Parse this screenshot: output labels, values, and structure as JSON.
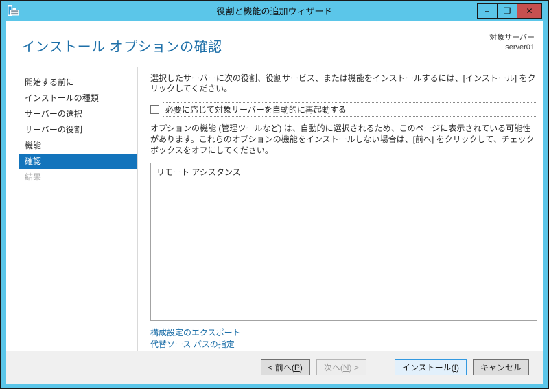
{
  "window": {
    "title": "役割と機能の追加ウィザード",
    "controls": {
      "minimize": "–",
      "maximize": "❐",
      "close": "✕"
    }
  },
  "header": {
    "title": "インストール オプションの確認",
    "target_server_label": "対象サーバー",
    "target_server_name": "server01"
  },
  "sidebar": {
    "items": [
      {
        "label": "開始する前に",
        "state": "normal"
      },
      {
        "label": "インストールの種類",
        "state": "normal"
      },
      {
        "label": "サーバーの選択",
        "state": "normal"
      },
      {
        "label": "サーバーの役割",
        "state": "normal"
      },
      {
        "label": "機能",
        "state": "normal"
      },
      {
        "label": "確認",
        "state": "selected"
      },
      {
        "label": "結果",
        "state": "disabled"
      }
    ]
  },
  "main": {
    "intro": "選択したサーバーに次の役割、役割サービス、または機能をインストールするには、[インストール] をクリックしてください。",
    "restart_checkbox": {
      "checked": false,
      "label": "必要に応じて対象サーバーを自動的に再起動する"
    },
    "note": "オプションの機能 (管理ツールなど) は、自動的に選択されるため、このページに表示されている可能性があります。これらのオプションの機能をインストールしない場合は、[前へ] をクリックして、チェック ボックスをオフにしてください。",
    "selection_list": [
      "リモート アシスタンス"
    ],
    "links": [
      {
        "label": "構成設定のエクスポート"
      },
      {
        "label": "代替ソース パスの指定"
      }
    ]
  },
  "footer": {
    "prev": {
      "prefix": "< 前へ(",
      "key": "P",
      "suffix": ")",
      "enabled": true
    },
    "next": {
      "prefix": "次へ(",
      "key": "N",
      "suffix": ") >",
      "enabled": false
    },
    "install": {
      "prefix": "インストール(",
      "key": "I",
      "suffix": ")",
      "enabled": true,
      "is_default": true
    },
    "cancel": {
      "label": "キャンセル",
      "enabled": true
    }
  },
  "colors": {
    "frame": "#5BC6E9",
    "outline": "#1A1A1A",
    "close_button_bg": "#C75050",
    "header_title": "#1D6FA8",
    "sidebar_selected_bg": "#1374BC",
    "link": "#1D6FA8",
    "footer_bg": "#F0F0F0",
    "default_button_bg": "#E2F0FB",
    "default_button_border": "#3399E0"
  }
}
